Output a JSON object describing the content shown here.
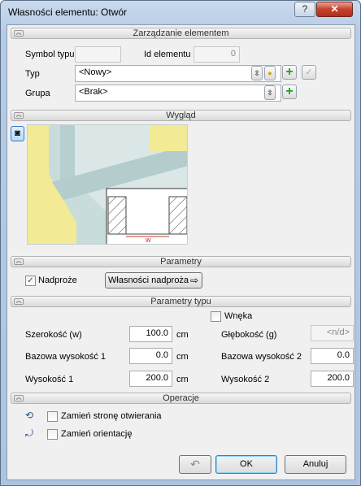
{
  "window": {
    "title": "Własności elementu: Otwór",
    "help_label": "?",
    "close_label": "✕"
  },
  "sections": {
    "management": "Zarządzanie elementem",
    "appearance": "Wygląd",
    "parameters": "Parametry",
    "type_parameters": "Parametry typu",
    "operations": "Operacje"
  },
  "management": {
    "symbol_label": "Symbol typu",
    "symbol_value": "",
    "id_label": "Id elementu",
    "id_value": "0",
    "type_label": "Typ",
    "type_value": "<Nowy>",
    "group_label": "Grupa",
    "group_value": "<Brak>"
  },
  "preview": {
    "dimension_label": "w"
  },
  "parameters": {
    "lintel_checkbox_label": "Nadproże",
    "lintel_checked": "✓",
    "lintel_props_button": "Własności nadproża"
  },
  "type_params": {
    "recess_label": "Wnęka",
    "width_label": "Szerokość (w)",
    "width_value": "100.0",
    "width_unit": "cm",
    "depth_label": "Głębokość (g)",
    "depth_value": "<n/d>",
    "base_height1_label": "Bazowa wysokość 1",
    "base_height1_value": "0.0",
    "base_height1_unit": "cm",
    "base_height2_label": "Bazowa wysokość 2",
    "base_height2_value": "0.0",
    "height1_label": "Wysokość 1",
    "height1_value": "200.0",
    "height1_unit": "cm",
    "height2_label": "Wysokość 2",
    "height2_value": "200.0"
  },
  "operations": {
    "swap_opening_label": "Zamień stronę otwierania",
    "swap_orientation_label": "Zamień orientację"
  },
  "footer": {
    "undo_label": "↶",
    "ok_label": "OK",
    "cancel_label": "Anuluj"
  }
}
